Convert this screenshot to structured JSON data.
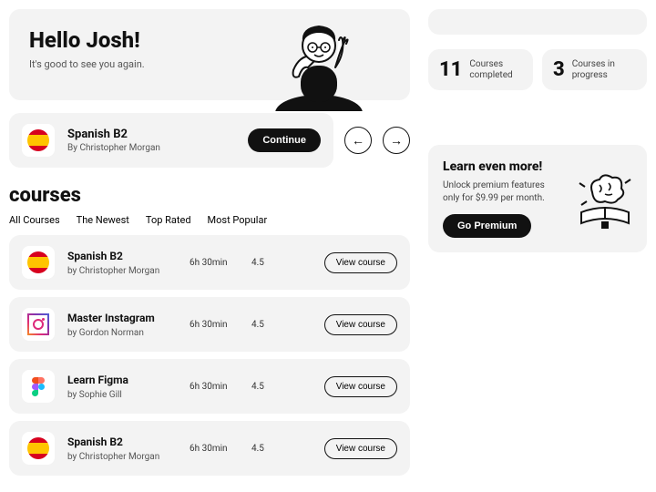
{
  "hero": {
    "title": "Hello Josh!",
    "subtitle": "It's good to see you again."
  },
  "continue": {
    "title": "Spanish B2",
    "by": "By Christopher Morgan",
    "button": "Continue",
    "icon": "flag-spain"
  },
  "courses": {
    "heading": "courses",
    "tabs": [
      "All Courses",
      "The Newest",
      "Top Rated",
      "Most Popular"
    ],
    "view_label": "View course",
    "items": [
      {
        "title": "Spanish B2",
        "by": "by Christopher Morgan",
        "duration": "6h 30min",
        "rating": "4.5",
        "icon": "flag-spain"
      },
      {
        "title": "Master Instagram",
        "by": "by Gordon Norman",
        "duration": "6h 30min",
        "rating": "4.5",
        "icon": "instagram"
      },
      {
        "title": "Learn Figma",
        "by": "by Sophie Gill",
        "duration": "6h 30min",
        "rating": "4.5",
        "icon": "figma"
      },
      {
        "title": "Spanish B2",
        "by": "by Christopher Morgan",
        "duration": "6h 30min",
        "rating": "4.5",
        "icon": "flag-spain"
      }
    ]
  },
  "stats": {
    "completed": {
      "num": "11",
      "label": "Courses completed"
    },
    "progress": {
      "num": "3",
      "label": "Courses in progress"
    }
  },
  "promo": {
    "title": "Learn even more!",
    "text": "Unlock premium features only for $9.99 per month.",
    "button": "Go Premium"
  }
}
